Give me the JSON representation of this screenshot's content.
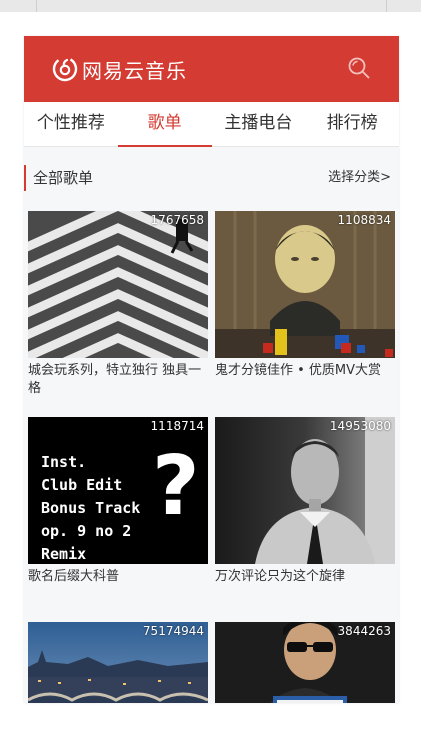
{
  "app": {
    "title": "网易云音乐"
  },
  "colors": {
    "brand": "#d43c33",
    "background": "#f6f7f9",
    "text": "#333333"
  },
  "header": {
    "logo_icon": "netease-music-logo-icon",
    "search_icon": "search-icon"
  },
  "tabs": [
    {
      "label": "个性推荐",
      "active": false
    },
    {
      "label": "歌单",
      "active": true
    },
    {
      "label": "主播电台",
      "active": false
    },
    {
      "label": "排行榜",
      "active": false
    }
  ],
  "section": {
    "title": "全部歌单",
    "more": "选择分类>"
  },
  "playlists": [
    {
      "count": "1767658",
      "name": "城会玩系列，特立独行 独具一格"
    },
    {
      "count": "1108834",
      "name": "鬼才分镜佳作 • 优质MV大赏"
    },
    {
      "count": "1118714",
      "name": "歌名后缀大科普",
      "cover_text": [
        "Inst.",
        "Club Edit",
        "Bonus Track",
        "op. 9 no 2",
        "Remix"
      ],
      "cover_symbol": "?"
    },
    {
      "count": "14953080",
      "name": "万次评论只为这个旋律"
    },
    {
      "count": "75174944",
      "name": ""
    },
    {
      "count": "3844263",
      "name": ""
    }
  ]
}
